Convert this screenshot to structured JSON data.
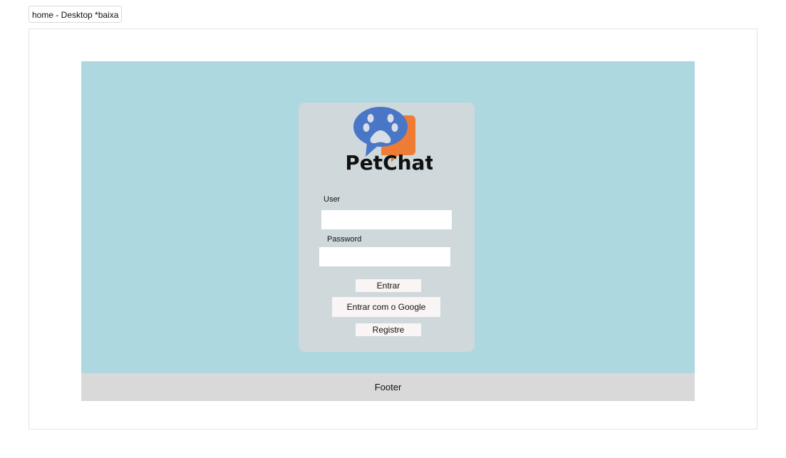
{
  "frame": {
    "tab_label": "home - Desktop *baixa"
  },
  "login": {
    "brand": "PetChat",
    "user_label": "User",
    "user_value": "",
    "password_label": "Password",
    "password_value": "",
    "login_button": "Entrar",
    "google_button": "Entrar com o Google",
    "register_button": "Registre"
  },
  "footer": {
    "text": "Footer"
  },
  "colors": {
    "canvas": "#add8e0",
    "card": "#cfd9dc",
    "footer": "#d9d9d9",
    "bubble_blue": "#4a76c8",
    "bubble_orange": "#ee7c35"
  }
}
